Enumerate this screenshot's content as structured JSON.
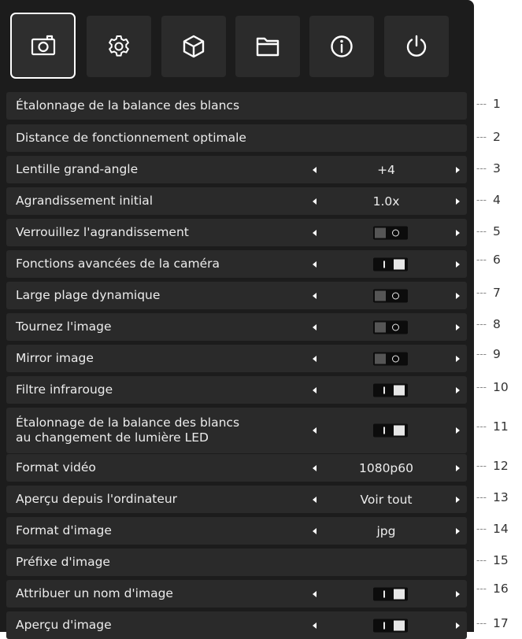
{
  "tabs": [
    {
      "icon": "camera-icon",
      "active": true
    },
    {
      "icon": "gear-icon",
      "active": false
    },
    {
      "icon": "cube-icon",
      "active": false
    },
    {
      "icon": "folder-icon",
      "active": false
    },
    {
      "icon": "info-icon",
      "active": false
    },
    {
      "icon": "power-icon",
      "active": false
    }
  ],
  "rows": [
    {
      "label": "Étalonnage de la balance des blancs",
      "control": "none"
    },
    {
      "label": "Distance de fonctionnement optimale",
      "control": "none"
    },
    {
      "label": "Lentille grand-angle",
      "control": "value",
      "value": "+4"
    },
    {
      "label": "Agrandissement initial",
      "control": "value",
      "value": "1.0x"
    },
    {
      "label": "Verrouillez l'agrandissement",
      "control": "toggle",
      "state": "off"
    },
    {
      "label": "Fonctions avancées de la caméra",
      "control": "toggle",
      "state": "on"
    },
    {
      "label": "Large plage dynamique",
      "control": "toggle",
      "state": "off"
    },
    {
      "label": "Tournez l'image",
      "control": "toggle",
      "state": "off"
    },
    {
      "label": "Mirror image",
      "control": "toggle",
      "state": "off"
    },
    {
      "label": "Filtre infrarouge",
      "control": "toggle",
      "state": "on"
    },
    {
      "label": "Étalonnage de la balance des blancs\nau changement de lumière LED",
      "control": "toggle",
      "state": "on"
    },
    {
      "label": "Format vidéo",
      "control": "value",
      "value": "1080p60"
    },
    {
      "label": "Aperçu depuis l'ordinateur",
      "control": "value",
      "value": "Voir tout"
    },
    {
      "label": "Format d'image",
      "control": "value",
      "value": "jpg"
    },
    {
      "label": "Préfixe d'image",
      "control": "none"
    },
    {
      "label": "Attribuer un nom d'image",
      "control": "toggle",
      "state": "on"
    },
    {
      "label": "Aperçu d'image",
      "control": "toggle",
      "state": "on"
    }
  ],
  "callouts": [
    "1",
    "2",
    "3",
    "4",
    "5",
    "6",
    "7",
    "8",
    "9",
    "10",
    "11",
    "12",
    "13",
    "14",
    "15",
    "16",
    "17"
  ],
  "colors": {
    "panel_bg": "#1c1c1c",
    "row_bg": "#2a2a2a",
    "text": "#ececec",
    "active_border": "#ffffff"
  }
}
